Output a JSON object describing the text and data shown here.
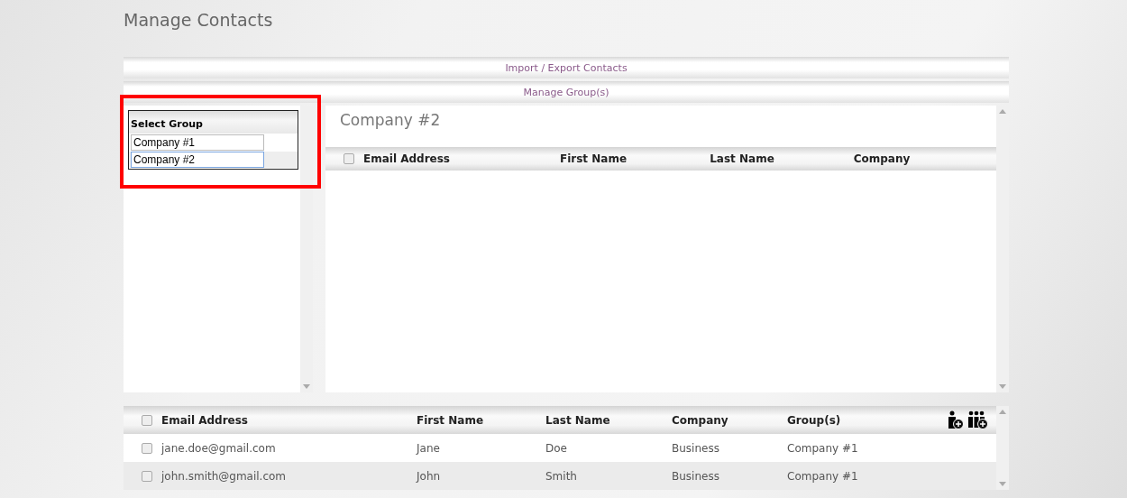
{
  "page_title": "Manage Contacts",
  "menu_bars": [
    {
      "label": "Import / Export Contacts"
    },
    {
      "label": "Manage Group(s)"
    }
  ],
  "group_list": {
    "header": "Select Group",
    "items": [
      {
        "label": "Company #1",
        "selected": false
      },
      {
        "label": "Company #2",
        "selected": true
      }
    ]
  },
  "group_detail": {
    "title": "Company #2",
    "header_checked": false,
    "columns": [
      "Email Address",
      "First Name",
      "Last Name",
      "Company"
    ]
  },
  "contacts_table": {
    "header_checked": false,
    "columns": [
      "Email Address",
      "First Name",
      "Last Name",
      "Company",
      "Group(s)"
    ],
    "rows": [
      {
        "checked": false,
        "cells": [
          "jane.doe@gmail.com",
          "Jane",
          "Doe",
          "Business",
          "Company #1"
        ]
      },
      {
        "checked": false,
        "cells": [
          "john.smith@gmail.com",
          "John",
          "Smith",
          "Business",
          "Company #1"
        ]
      }
    ]
  }
}
